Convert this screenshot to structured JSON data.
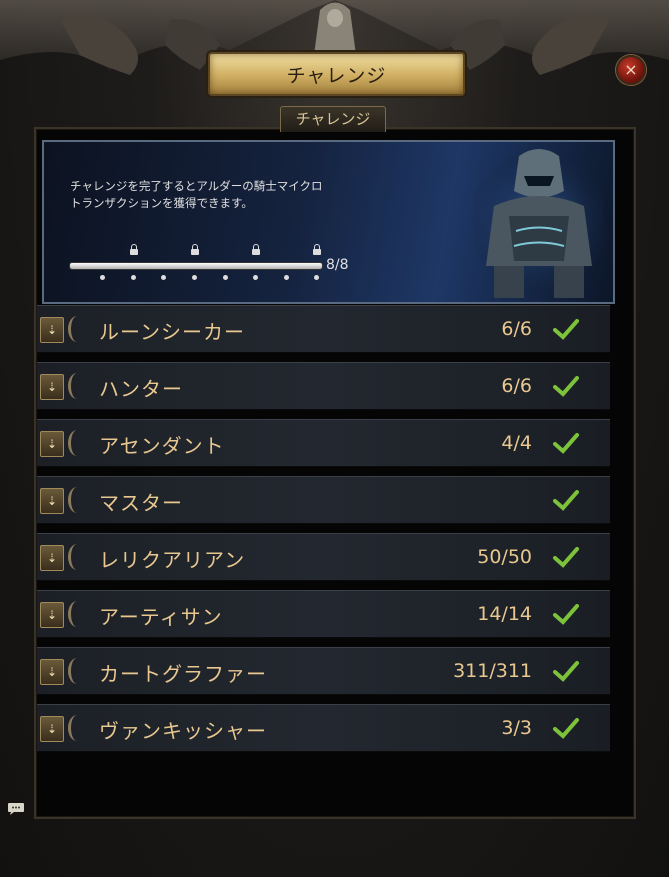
{
  "window": {
    "title": "チャレンジ",
    "close_label": "×"
  },
  "tabs": [
    {
      "label": "チャレンジ"
    }
  ],
  "banner": {
    "description": "チャレンジを完了するとアルダーの騎士マイクロトランザクションを獲得できます。",
    "progress": {
      "current": 8,
      "total": 8,
      "label": "8/8"
    }
  },
  "challenges": [
    {
      "name": "ルーンシーカー",
      "count": "6/6",
      "completed": true
    },
    {
      "name": "ハンター",
      "count": "6/6",
      "completed": true
    },
    {
      "name": "アセンダント",
      "count": "4/4",
      "completed": true
    },
    {
      "name": "マスター",
      "count": "",
      "completed": true
    },
    {
      "name": "レリクアリアン",
      "count": "50/50",
      "completed": true
    },
    {
      "name": "アーティサン",
      "count": "14/14",
      "completed": true
    },
    {
      "name": "カートグラファー",
      "count": "311/311",
      "completed": true
    },
    {
      "name": "ヴァンキッシャー",
      "count": "3/3",
      "completed": true
    }
  ],
  "icons": {
    "expand": "expand-icon",
    "check": "check-icon",
    "close": "close-icon",
    "lock": "lock-icon",
    "chat": "chat-icon"
  },
  "colors": {
    "accent_gold": "#e9c890",
    "check_green": "#7cc23a",
    "banner_blue": "#1e3766"
  }
}
